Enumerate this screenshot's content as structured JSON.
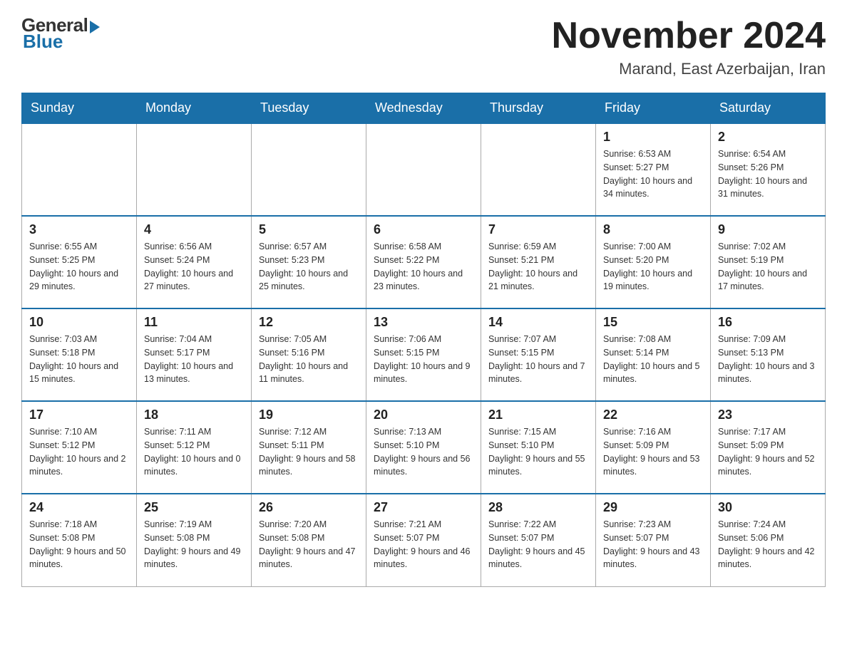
{
  "logo": {
    "general": "General",
    "blue": "Blue"
  },
  "title": {
    "month_year": "November 2024",
    "location": "Marand, East Azerbaijan, Iran"
  },
  "weekdays": [
    "Sunday",
    "Monday",
    "Tuesday",
    "Wednesday",
    "Thursday",
    "Friday",
    "Saturday"
  ],
  "weeks": [
    [
      {
        "day": "",
        "sunrise": "",
        "sunset": "",
        "daylight": ""
      },
      {
        "day": "",
        "sunrise": "",
        "sunset": "",
        "daylight": ""
      },
      {
        "day": "",
        "sunrise": "",
        "sunset": "",
        "daylight": ""
      },
      {
        "day": "",
        "sunrise": "",
        "sunset": "",
        "daylight": ""
      },
      {
        "day": "",
        "sunrise": "",
        "sunset": "",
        "daylight": ""
      },
      {
        "day": "1",
        "sunrise": "Sunrise: 6:53 AM",
        "sunset": "Sunset: 5:27 PM",
        "daylight": "Daylight: 10 hours and 34 minutes."
      },
      {
        "day": "2",
        "sunrise": "Sunrise: 6:54 AM",
        "sunset": "Sunset: 5:26 PM",
        "daylight": "Daylight: 10 hours and 31 minutes."
      }
    ],
    [
      {
        "day": "3",
        "sunrise": "Sunrise: 6:55 AM",
        "sunset": "Sunset: 5:25 PM",
        "daylight": "Daylight: 10 hours and 29 minutes."
      },
      {
        "day": "4",
        "sunrise": "Sunrise: 6:56 AM",
        "sunset": "Sunset: 5:24 PM",
        "daylight": "Daylight: 10 hours and 27 minutes."
      },
      {
        "day": "5",
        "sunrise": "Sunrise: 6:57 AM",
        "sunset": "Sunset: 5:23 PM",
        "daylight": "Daylight: 10 hours and 25 minutes."
      },
      {
        "day": "6",
        "sunrise": "Sunrise: 6:58 AM",
        "sunset": "Sunset: 5:22 PM",
        "daylight": "Daylight: 10 hours and 23 minutes."
      },
      {
        "day": "7",
        "sunrise": "Sunrise: 6:59 AM",
        "sunset": "Sunset: 5:21 PM",
        "daylight": "Daylight: 10 hours and 21 minutes."
      },
      {
        "day": "8",
        "sunrise": "Sunrise: 7:00 AM",
        "sunset": "Sunset: 5:20 PM",
        "daylight": "Daylight: 10 hours and 19 minutes."
      },
      {
        "day": "9",
        "sunrise": "Sunrise: 7:02 AM",
        "sunset": "Sunset: 5:19 PM",
        "daylight": "Daylight: 10 hours and 17 minutes."
      }
    ],
    [
      {
        "day": "10",
        "sunrise": "Sunrise: 7:03 AM",
        "sunset": "Sunset: 5:18 PM",
        "daylight": "Daylight: 10 hours and 15 minutes."
      },
      {
        "day": "11",
        "sunrise": "Sunrise: 7:04 AM",
        "sunset": "Sunset: 5:17 PM",
        "daylight": "Daylight: 10 hours and 13 minutes."
      },
      {
        "day": "12",
        "sunrise": "Sunrise: 7:05 AM",
        "sunset": "Sunset: 5:16 PM",
        "daylight": "Daylight: 10 hours and 11 minutes."
      },
      {
        "day": "13",
        "sunrise": "Sunrise: 7:06 AM",
        "sunset": "Sunset: 5:15 PM",
        "daylight": "Daylight: 10 hours and 9 minutes."
      },
      {
        "day": "14",
        "sunrise": "Sunrise: 7:07 AM",
        "sunset": "Sunset: 5:15 PM",
        "daylight": "Daylight: 10 hours and 7 minutes."
      },
      {
        "day": "15",
        "sunrise": "Sunrise: 7:08 AM",
        "sunset": "Sunset: 5:14 PM",
        "daylight": "Daylight: 10 hours and 5 minutes."
      },
      {
        "day": "16",
        "sunrise": "Sunrise: 7:09 AM",
        "sunset": "Sunset: 5:13 PM",
        "daylight": "Daylight: 10 hours and 3 minutes."
      }
    ],
    [
      {
        "day": "17",
        "sunrise": "Sunrise: 7:10 AM",
        "sunset": "Sunset: 5:12 PM",
        "daylight": "Daylight: 10 hours and 2 minutes."
      },
      {
        "day": "18",
        "sunrise": "Sunrise: 7:11 AM",
        "sunset": "Sunset: 5:12 PM",
        "daylight": "Daylight: 10 hours and 0 minutes."
      },
      {
        "day": "19",
        "sunrise": "Sunrise: 7:12 AM",
        "sunset": "Sunset: 5:11 PM",
        "daylight": "Daylight: 9 hours and 58 minutes."
      },
      {
        "day": "20",
        "sunrise": "Sunrise: 7:13 AM",
        "sunset": "Sunset: 5:10 PM",
        "daylight": "Daylight: 9 hours and 56 minutes."
      },
      {
        "day": "21",
        "sunrise": "Sunrise: 7:15 AM",
        "sunset": "Sunset: 5:10 PM",
        "daylight": "Daylight: 9 hours and 55 minutes."
      },
      {
        "day": "22",
        "sunrise": "Sunrise: 7:16 AM",
        "sunset": "Sunset: 5:09 PM",
        "daylight": "Daylight: 9 hours and 53 minutes."
      },
      {
        "day": "23",
        "sunrise": "Sunrise: 7:17 AM",
        "sunset": "Sunset: 5:09 PM",
        "daylight": "Daylight: 9 hours and 52 minutes."
      }
    ],
    [
      {
        "day": "24",
        "sunrise": "Sunrise: 7:18 AM",
        "sunset": "Sunset: 5:08 PM",
        "daylight": "Daylight: 9 hours and 50 minutes."
      },
      {
        "day": "25",
        "sunrise": "Sunrise: 7:19 AM",
        "sunset": "Sunset: 5:08 PM",
        "daylight": "Daylight: 9 hours and 49 minutes."
      },
      {
        "day": "26",
        "sunrise": "Sunrise: 7:20 AM",
        "sunset": "Sunset: 5:08 PM",
        "daylight": "Daylight: 9 hours and 47 minutes."
      },
      {
        "day": "27",
        "sunrise": "Sunrise: 7:21 AM",
        "sunset": "Sunset: 5:07 PM",
        "daylight": "Daylight: 9 hours and 46 minutes."
      },
      {
        "day": "28",
        "sunrise": "Sunrise: 7:22 AM",
        "sunset": "Sunset: 5:07 PM",
        "daylight": "Daylight: 9 hours and 45 minutes."
      },
      {
        "day": "29",
        "sunrise": "Sunrise: 7:23 AM",
        "sunset": "Sunset: 5:07 PM",
        "daylight": "Daylight: 9 hours and 43 minutes."
      },
      {
        "day": "30",
        "sunrise": "Sunrise: 7:24 AM",
        "sunset": "Sunset: 5:06 PM",
        "daylight": "Daylight: 9 hours and 42 minutes."
      }
    ]
  ]
}
